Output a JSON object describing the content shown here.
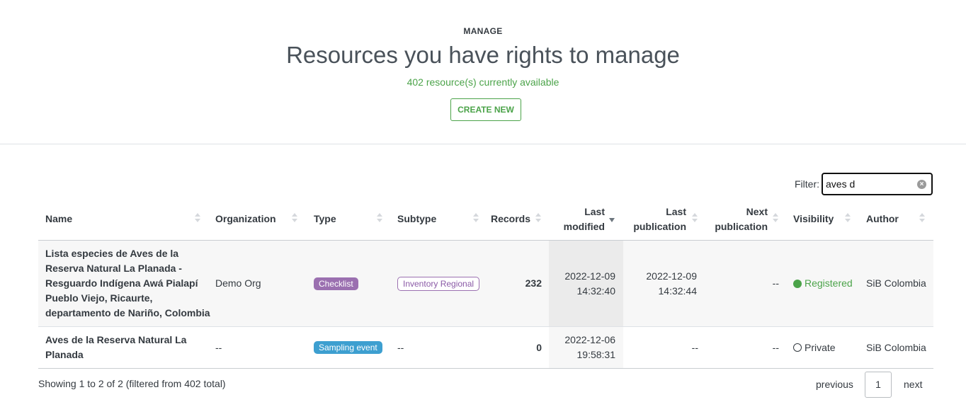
{
  "header": {
    "eyebrow": "MANAGE",
    "title": "Resources you have rights to manage",
    "subtitle": "402 resource(s) currently available",
    "create_label": "CREATE NEW"
  },
  "filter": {
    "label": "Filter:",
    "value": "aves d",
    "clear_icon": "×"
  },
  "table": {
    "columns": [
      {
        "label": "Name",
        "line2": ""
      },
      {
        "label": "Organization",
        "line2": ""
      },
      {
        "label": "Type",
        "line2": ""
      },
      {
        "label": "Subtype",
        "line2": ""
      },
      {
        "label": "Records",
        "line2": ""
      },
      {
        "label": "Last",
        "line2": "modified"
      },
      {
        "label": "Last",
        "line2": "publication"
      },
      {
        "label": "Next",
        "line2": "publication"
      },
      {
        "label": "Visibility",
        "line2": ""
      },
      {
        "label": "Author",
        "line2": ""
      }
    ],
    "rows": [
      {
        "name_l1": "Lista especies de Aves de la",
        "name_l2": "Reserva Natural La Planada -",
        "name_l3": "Resguardo Indígena Awá Pialapí",
        "name_l4": "Pueblo Viejo, Ricaurte,",
        "name_l5": "departamento de Nariño, Colombia",
        "organization": "Demo Org",
        "type": "Checklist",
        "subtype": "Inventory Regional",
        "records": "232",
        "last_modified_date": "2022-12-09",
        "last_modified_time": "14:32:40",
        "last_publication_date": "2022-12-09",
        "last_publication_time": "14:32:44",
        "next_publication": "--",
        "visibility": "Registered",
        "author": "SiB Colombia"
      },
      {
        "name_l1": "Aves de la Reserva Natural La",
        "name_l2": "Planada",
        "organization": "--",
        "type": "Sampling event",
        "subtype": "--",
        "records": "0",
        "last_modified_date": "2022-12-06",
        "last_modified_time": "19:58:31",
        "last_publication": "--",
        "next_publication": "--",
        "visibility": "Private",
        "author": "SiB Colombia"
      }
    ]
  },
  "footer": {
    "info": "Showing 1 to 2 of 2 (filtered from 402 total)",
    "previous": "previous",
    "page": "1",
    "next": "next"
  },
  "colors": {
    "accent_green": "#4ba349",
    "checklist_badge": "#9b70b0",
    "sampling_badge": "#3d9fd0"
  }
}
